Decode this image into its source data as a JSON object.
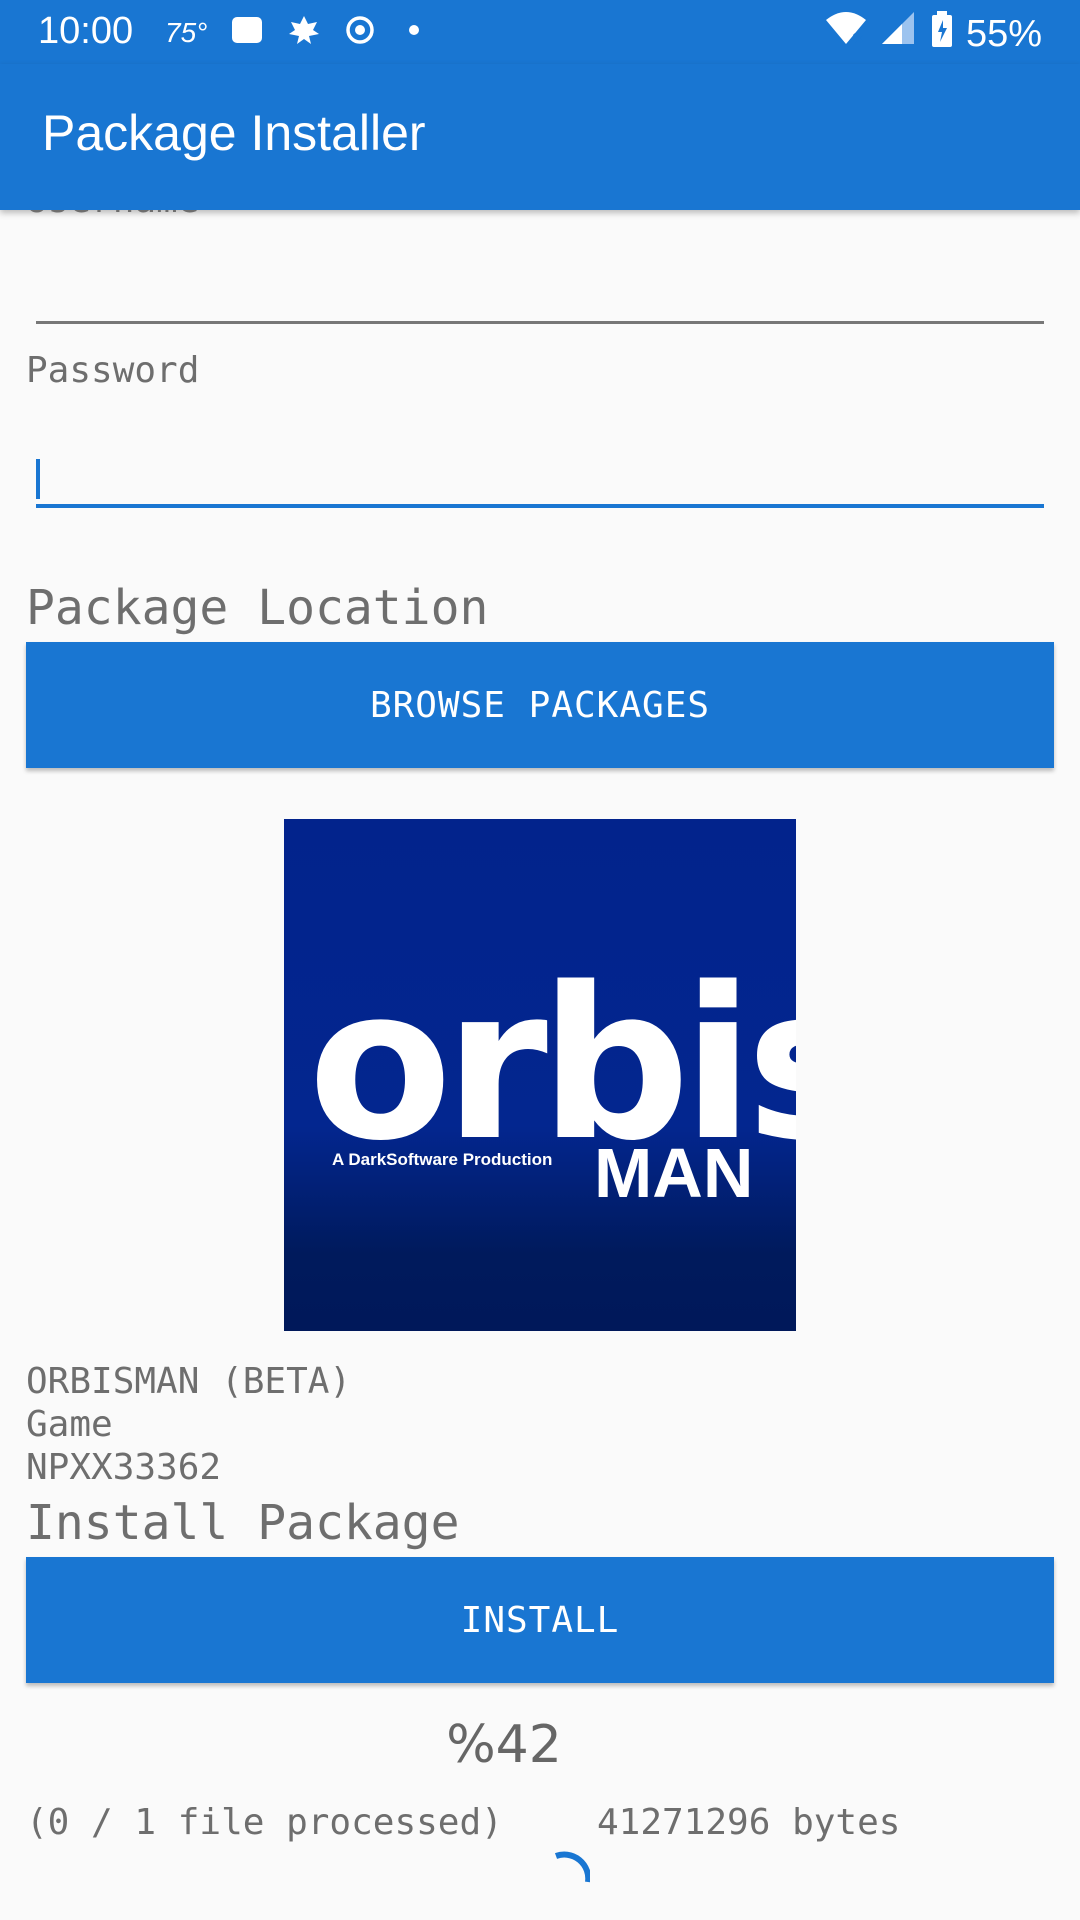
{
  "status_bar": {
    "time": "10:00",
    "temperature": "75°",
    "battery": "55%",
    "icons": [
      "square-notification-icon",
      "leaf-icon",
      "target-icon",
      "dot-icon",
      "wifi-icon",
      "signal-icon",
      "battery-icon"
    ]
  },
  "app_bar": {
    "title": "Package Installer"
  },
  "form": {
    "username_label": "Username",
    "username_value": "",
    "password_label": "Password",
    "password_value": ""
  },
  "package_location": {
    "heading": "Package Location",
    "browse_label": "BROWSE PACKAGES"
  },
  "package": {
    "logo_word": "orbis",
    "logo_sub": "MAN",
    "logo_tagline": "A DarkSoftware Production",
    "name": "ORBISMAN (BETA)",
    "type": "Game",
    "id": "NPXX33362"
  },
  "install": {
    "heading": "Install Package",
    "button_label": "INSTALL",
    "progress_text": "%42",
    "progress": 0.42,
    "files_processed": "(0 / 1 file processed)",
    "bytes": "41271296 bytes"
  },
  "colors": {
    "primary": "#1976d2",
    "text_gray": "#6e6e6e",
    "logo_blue": "#02238c"
  }
}
